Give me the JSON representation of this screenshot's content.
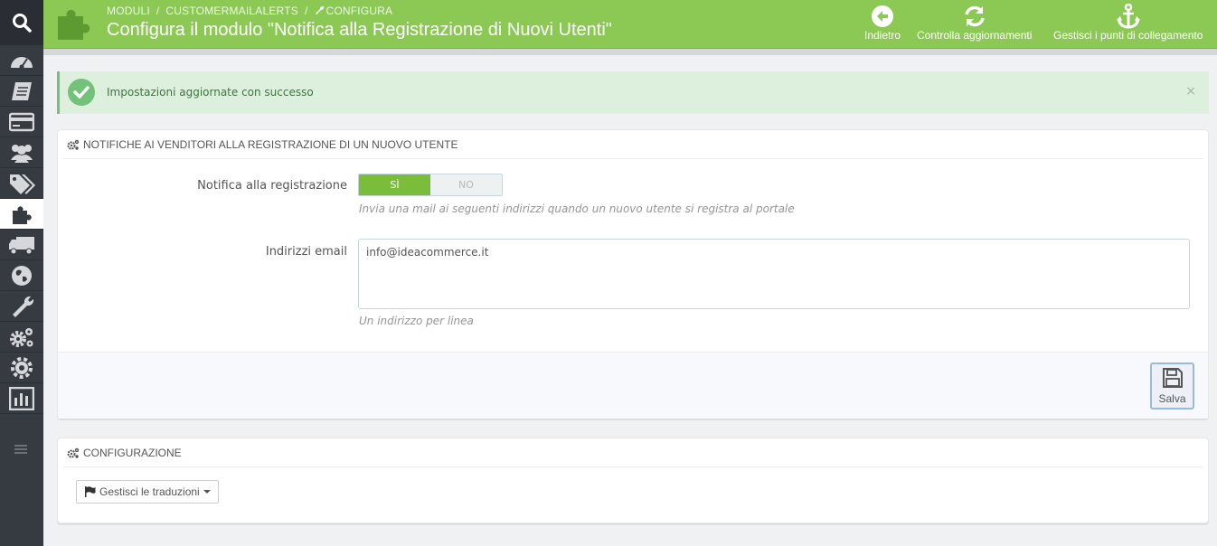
{
  "breadcrumb": {
    "item1": "MODULI",
    "item2": "CUSTOMERMAILALERTS",
    "item3": "CONFIGURA"
  },
  "page_title": "Configura il modulo \"Notifica alla Registrazione di Nuovi Utenti\"",
  "toolbar": {
    "back": "Indietro",
    "check_updates": "Controlla aggiornamenti",
    "hooks": "Gestisci i punti di collegamento"
  },
  "sidebar": {
    "items": [
      "dashboard-icon",
      "orders-icon",
      "payment-icon",
      "customers-icon",
      "catalog-icon",
      "modules-icon",
      "shipping-icon",
      "localization-icon",
      "preferences-icon",
      "advanced-icon",
      "administration-icon",
      "stats-icon"
    ]
  },
  "alert": {
    "message": "Impostazioni aggiornate con successo",
    "close": "×"
  },
  "panel1": {
    "title": "NOTIFICHE AI VENDITORI ALLA REGISTRAZIONE DI UN NUOVO UTENTE",
    "notify_label": "Notifica alla registrazione",
    "switch_yes": "SÌ",
    "switch_no": "NO",
    "notify_help": "Invia una mail ai seguenti indirizzi quando un nuovo utente si registra al portale",
    "emails_label": "Indirizzi email",
    "emails_value": "info@ideacommerce.it",
    "emails_help": "Un indirizzo per linea",
    "save": "Salva"
  },
  "panel2": {
    "title": "CONFIGURAZIONE",
    "translations_button": "Gestisci le traduzioni"
  },
  "colors": {
    "header": "#8bc954",
    "sidebar": "#363a41",
    "switch_on": "#79bd3a",
    "alert_bg": "#ddf0de"
  }
}
